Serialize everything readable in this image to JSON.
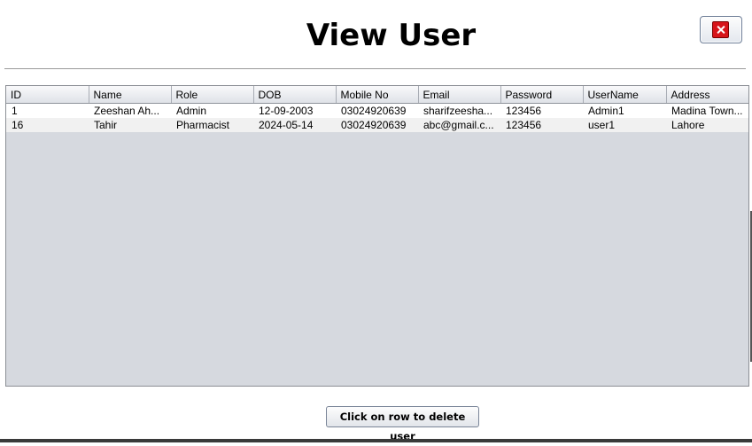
{
  "window": {
    "title": "View User",
    "close_icon": "close-icon"
  },
  "users_table": {
    "columns": [
      "ID",
      "Name",
      "Role",
      "DOB",
      "Mobile No",
      "Email",
      "Password",
      "UserName",
      "Address"
    ],
    "rows": [
      [
        "1",
        "Zeeshan Ah...",
        "Admin",
        "12-09-2003",
        "03024920639",
        "sharifzeesha...",
        "123456",
        "Admin1",
        "Madina Town..."
      ],
      [
        "16",
        "Tahir",
        "Pharmacist",
        "2024-05-14",
        "03024920639",
        "abc@gmail.c...",
        "123456",
        "user1",
        "Lahore"
      ]
    ]
  },
  "footer": {
    "delete_hint_label": "Click on row to delete user"
  }
}
